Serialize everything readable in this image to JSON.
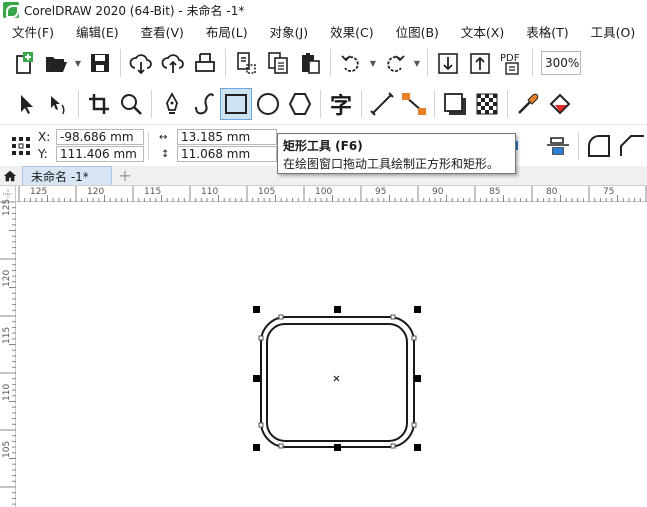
{
  "window": {
    "title": "CorelDRAW 2020 (64-Bit) - 未命名 -1*"
  },
  "menu": [
    "文件(F)",
    "编辑(E)",
    "查看(V)",
    "布局(L)",
    "对象(J)",
    "效果(C)",
    "位图(B)",
    "文本(X)",
    "表格(T)",
    "工具(O)"
  ],
  "toolbar": {
    "zoom": "300%",
    "pdf_label": "PDF"
  },
  "toolbox": {
    "text_tool_glyph": "字"
  },
  "properties": {
    "x_label": "X:",
    "x_value": "-98.686 mm",
    "y_label": "Y:",
    "y_value": "111.406 mm",
    "width_value": "13.185 mm",
    "height_value": "11.068 mm"
  },
  "tooltip": {
    "title": "矩形工具 (F6)",
    "description": "在绘图窗口拖动工具绘制正方形和矩形。"
  },
  "document_tab": {
    "label": "未命名 -1*"
  },
  "ruler": {
    "horizontal": [
      "125",
      "120",
      "115",
      "110",
      "105",
      "100",
      "95",
      "90",
      "85",
      "80",
      "75"
    ],
    "vertical": [
      "125",
      "120",
      "115",
      "110",
      "105"
    ]
  },
  "colors": {
    "accent": "#cde4f7",
    "active_border": "#6aa9e0",
    "rectangle_stroke": "#1a1a1a"
  }
}
